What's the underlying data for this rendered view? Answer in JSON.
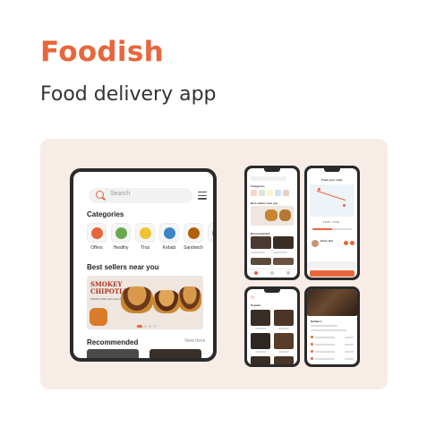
{
  "header": {
    "brand": "Foodish",
    "tagline": "Food delivery app"
  },
  "colors": {
    "accent": "#e8663b",
    "panel_bg": "#f8ece6",
    "device_frame": "#2a2a2a"
  },
  "tablet": {
    "search_placeholder": "Search",
    "categories_heading": "Categories",
    "categories": [
      {
        "label": "Offers",
        "icon": "offers-icon",
        "color": "#e8663b"
      },
      {
        "label": "Healthy",
        "icon": "salad-icon",
        "color": "#6aa84f"
      },
      {
        "label": "Thai",
        "icon": "noodles-icon",
        "color": "#f1c232"
      },
      {
        "label": "Kebab",
        "icon": "kebab-icon",
        "color": "#3d85c6"
      },
      {
        "label": "Sandwich",
        "icon": "sandwich-icon",
        "color": "#b45f06"
      },
      {
        "label": "T",
        "icon": "more-icon",
        "color": "#999999"
      }
    ],
    "best_sellers_heading": "Best sellers near you",
    "banner": {
      "title_line1": "SMOKEY",
      "title_line2": "CHIPOTLE",
      "subtitle": "FRESH FIRE-GRILLED BURGER"
    },
    "recommended_heading": "Recommended",
    "view_more": "View more"
  },
  "phones": {
    "home_screen": {
      "heading": "Categories",
      "sellers_heading": "Best sellers near you",
      "recommended_heading": "Recommended"
    },
    "tracking_screen": {
      "title": "Track your order",
      "time": "13:00 - 13:30",
      "courier": "Dexter Jack"
    },
    "popular_screen": {
      "heading": "Popular"
    },
    "detail_screen": {
      "heading": "Nathan's"
    }
  }
}
